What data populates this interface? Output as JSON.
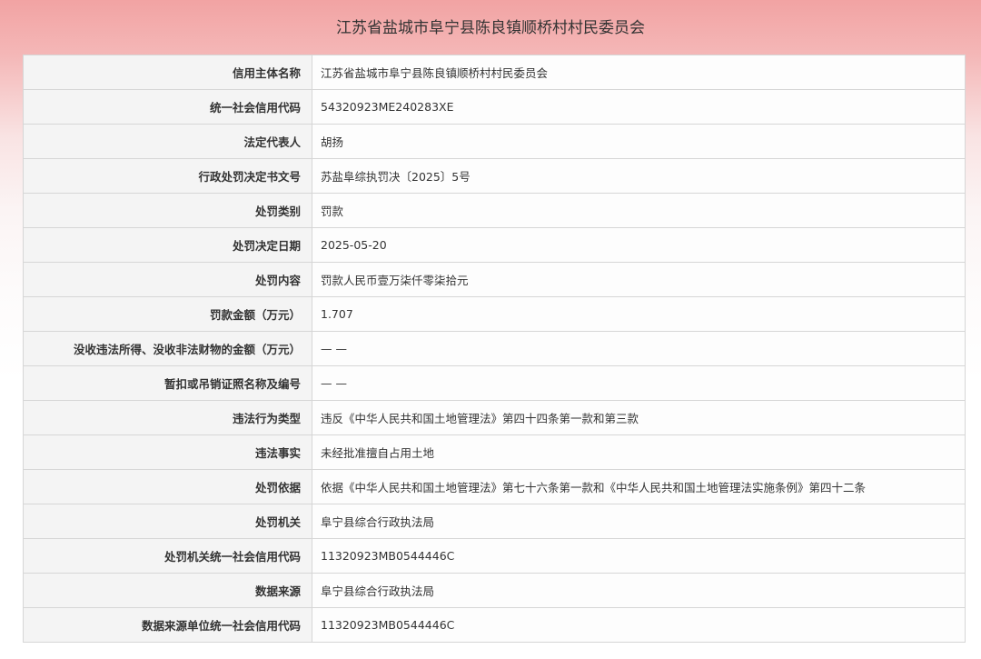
{
  "page": {
    "title": "江苏省盐城市阜宁县陈良镇顺桥村村民委员会"
  },
  "rows": [
    {
      "label": "信用主体名称",
      "value": "江苏省盐城市阜宁县陈良镇顺桥村村民委员会"
    },
    {
      "label": "统一社会信用代码",
      "value": "54320923ME240283XE"
    },
    {
      "label": "法定代表人",
      "value": "胡扬"
    },
    {
      "label": "行政处罚决定书文号",
      "value": "苏盐阜综执罚决〔2025〕5号"
    },
    {
      "label": "处罚类别",
      "value": "罚款"
    },
    {
      "label": "处罚决定日期",
      "value": "2025-05-20"
    },
    {
      "label": "处罚内容",
      "value": "罚款人民币壹万柒仟零柒拾元"
    },
    {
      "label": "罚款金额（万元）",
      "value": "1.707"
    },
    {
      "label": "没收违法所得、没收非法财物的金额（万元）",
      "value": "— —"
    },
    {
      "label": "暂扣或吊销证照名称及编号",
      "value": "— —"
    },
    {
      "label": "违法行为类型",
      "value": "违反《中华人民共和国土地管理法》第四十四条第一款和第三款"
    },
    {
      "label": "违法事实",
      "value": "未经批准擅自占用土地"
    },
    {
      "label": "处罚依据",
      "value": "依据《中华人民共和国土地管理法》第七十六条第一款和《中华人民共和国土地管理法实施条例》第四十二条"
    },
    {
      "label": "处罚机关",
      "value": "阜宁县综合行政执法局"
    },
    {
      "label": "处罚机关统一社会信用代码",
      "value": "11320923MB0544446C"
    },
    {
      "label": "数据来源",
      "value": "阜宁县综合行政执法局"
    },
    {
      "label": "数据来源单位统一社会信用代码",
      "value": "11320923MB0544446C"
    }
  ]
}
